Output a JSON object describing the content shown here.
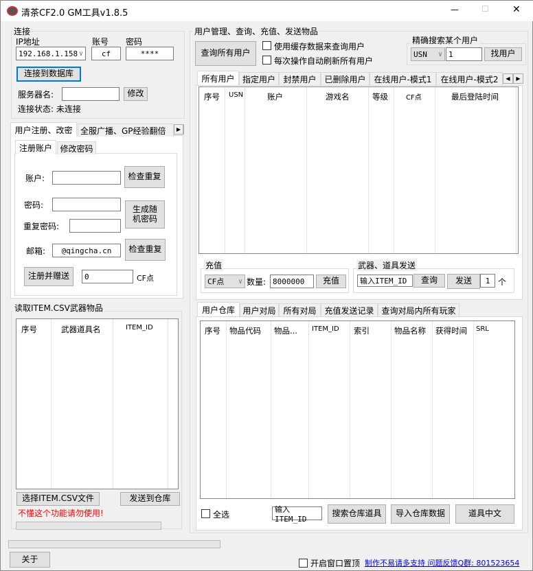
{
  "window": {
    "title": "清茶CF2.0 GM工具v1.8.5",
    "minimize": "—",
    "maximize": "☐",
    "close": "✕"
  },
  "connection": {
    "label": "连接",
    "ip_label": "IP地址",
    "ip_value": "192.168.1.158",
    "account_label": "账号",
    "account_value": "cf",
    "password_label": "密码",
    "password_value": "****",
    "connect_button": "连接到数据库",
    "server_name_label": "服务器名:",
    "server_name_value": "",
    "modify_button": "修改",
    "status_text": "连接状态: 未连接"
  },
  "left_tabs": {
    "tabs": [
      "用户注册、改密",
      "全服广播、GP经验翻倍"
    ],
    "inner_tabs": [
      "注册账户",
      "修改密码"
    ],
    "register": {
      "account_label": "账户:",
      "check_dup": "检查重复",
      "password_label": "密码:",
      "repeat_label": "重复密码:",
      "random_button": "生成随机密码",
      "email_label": "邮箱:",
      "email_value": "@qingcha.cn",
      "check_dup2": "检查重复",
      "register_button": "注册并赠送",
      "cf_value": "0",
      "cf_unit": "CF点"
    }
  },
  "csv": {
    "label": "读取ITEM.CSV武器物品",
    "columns": [
      "序号",
      "武器道具名",
      "ITEM_ID"
    ],
    "select_button": "选择ITEM.CSV文件",
    "send_button": "发送到仓库",
    "warning": "不懂这个功能请勿使用!",
    "warning_color": "#ff0000"
  },
  "user_mgmt": {
    "label": "用户管理、查询、充值、发送物品",
    "query_all": "查询所有用户",
    "use_cache": "使用缓存数据来查询用户",
    "auto_refresh": "每次操作自动刷新所有用户",
    "search": {
      "label": "精确搜索某个用户",
      "field": "USN",
      "value": "1",
      "button": "找用户"
    },
    "tabs": [
      "所有用户",
      "指定用户",
      "封禁用户",
      "已删除用户",
      "在线用户-模式1",
      "在线用户-模式2"
    ],
    "columns": [
      "序号",
      "USN",
      "账户",
      "游戏名",
      "等级",
      "CF点",
      "最后登陆时间"
    ],
    "recharge": {
      "label": "充值",
      "type": "CF点",
      "qty_label": "数量:",
      "qty_value": "8000000",
      "button": "充值"
    },
    "send": {
      "label": "武器、道具发送",
      "item_input": "输入ITEM_ID",
      "query_button": "查询",
      "send_button": "发送",
      "count": "1",
      "unit": "个"
    }
  },
  "inventory": {
    "tabs": [
      "用户仓库",
      "用户对局",
      "所有对局",
      "充值发送记录",
      "查询对局内所有玩家"
    ],
    "columns": [
      "序号",
      "物品代码",
      "物品...",
      "ITEM_ID",
      "索引",
      "物品名称",
      "获得时间",
      "SRL"
    ],
    "select_all": "全选",
    "item_input": "输入ITEM_ID",
    "search_button": "搜索仓库道具",
    "import_button": "导入仓库数据",
    "chinese_button": "道具中文"
  },
  "footer": {
    "about": "关于",
    "topmost": "开启窗口置顶",
    "link": "制作不易请多支持 问题反馈Q群: 801523654",
    "link_color": "#0000ee"
  }
}
